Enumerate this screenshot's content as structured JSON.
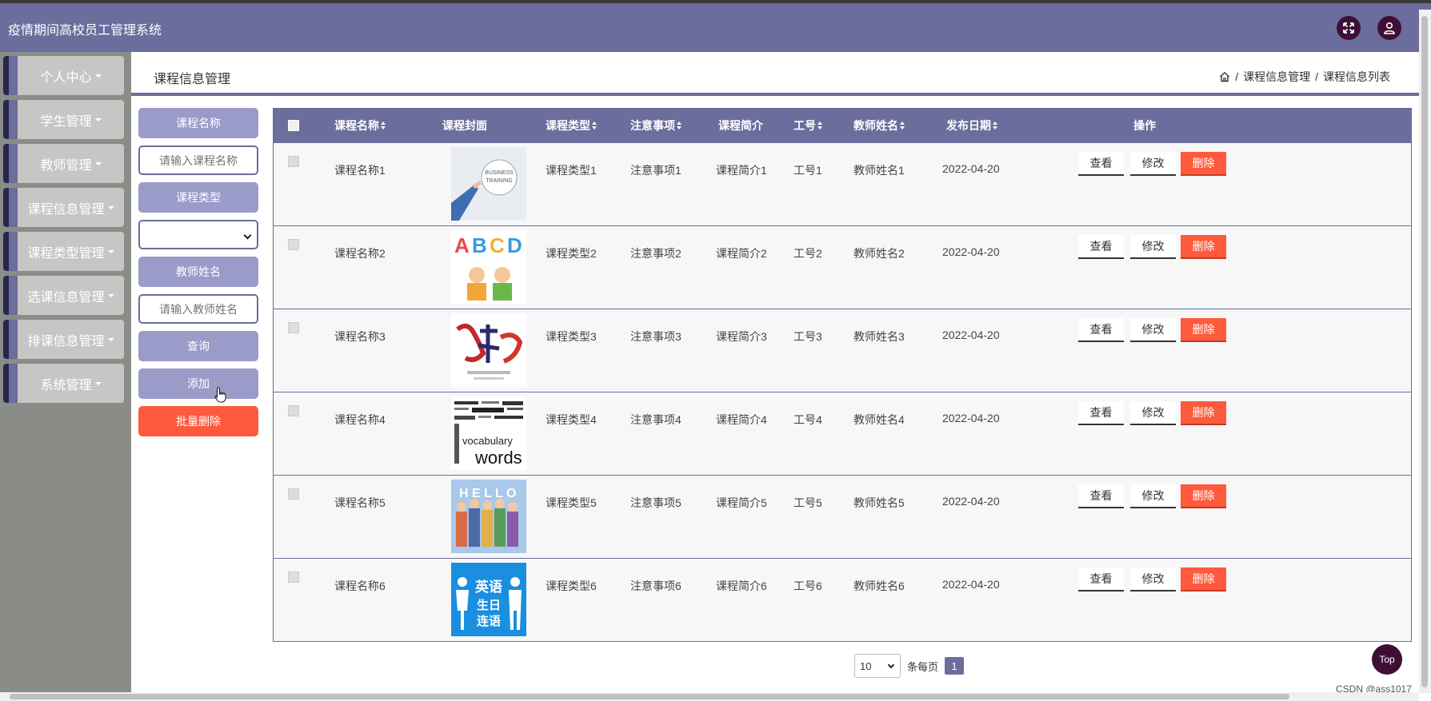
{
  "app": {
    "title": "疫情期间高校员工管理系统"
  },
  "header_icons": {
    "fullscreen": "fullscreen-icon",
    "user": "user-icon"
  },
  "sidebar": {
    "items": [
      {
        "label": "个人中心"
      },
      {
        "label": "学生管理"
      },
      {
        "label": "教师管理"
      },
      {
        "label": "课程信息管理"
      },
      {
        "label": "课程类型管理"
      },
      {
        "label": "选课信息管理"
      },
      {
        "label": "排课信息管理"
      },
      {
        "label": "系统管理"
      }
    ]
  },
  "page": {
    "title": "课程信息管理",
    "breadcrumb": {
      "sep": "/",
      "level1": "课程信息管理",
      "level2": "课程信息列表"
    }
  },
  "filters": {
    "name_label": "课程名称",
    "name_placeholder": "请输入课程名称",
    "type_label": "课程类型",
    "type_value": "",
    "teacher_label": "教师姓名",
    "teacher_placeholder": "请输入教师姓名",
    "search_label": "查询",
    "add_label": "添加",
    "batch_delete_label": "批量删除"
  },
  "table": {
    "headers": {
      "name": "课程名称",
      "cover": "课程封面",
      "type": "课程类型",
      "notes": "注意事项",
      "intro": "课程简介",
      "id": "工号",
      "teacher": "教师姓名",
      "date": "发布日期",
      "actions": "操作"
    },
    "action_labels": {
      "view": "查看",
      "edit": "修改",
      "delete": "删除"
    },
    "rows": [
      {
        "name": "课程名称1",
        "type": "课程类型1",
        "notes": "注意事项1",
        "intro": "课程简介1",
        "id": "工号1",
        "teacher": "教师姓名1",
        "date": "2022-04-20",
        "cover_text": "BUSINESS TRAINING"
      },
      {
        "name": "课程名称2",
        "type": "课程类型2",
        "notes": "注意事项2",
        "intro": "课程简介2",
        "id": "工号2",
        "teacher": "教师姓名2",
        "date": "2022-04-20",
        "cover_text": "ABCD"
      },
      {
        "name": "课程名称3",
        "type": "课程类型3",
        "notes": "注意事项3",
        "intro": "课程简介3",
        "id": "工号3",
        "teacher": "教师姓名3",
        "date": "2022-04-20",
        "cover_text": "健身操"
      },
      {
        "name": "课程名称4",
        "type": "课程类型4",
        "notes": "注意事项4",
        "intro": "课程简介4",
        "id": "工号4",
        "teacher": "教师姓名4",
        "date": "2022-04-20",
        "cover_text": "vocabulary words"
      },
      {
        "name": "课程名称5",
        "type": "课程类型5",
        "notes": "注意事项5",
        "intro": "课程简介5",
        "id": "工号5",
        "teacher": "教师姓名5",
        "date": "2022-04-20",
        "cover_text": "HELLO"
      },
      {
        "name": "课程名称6",
        "type": "课程类型6",
        "notes": "注意事项6",
        "intro": "课程简介6",
        "id": "工号6",
        "teacher": "教师姓名6",
        "date": "2022-04-20",
        "cover_text": "英语 生日 连语"
      }
    ]
  },
  "pagination": {
    "page_size": "10",
    "per_page_label": "条每页",
    "current_page": "1"
  },
  "top_button": "Top",
  "watermark": "CSDN @ass1017",
  "colors": {
    "primary": "#6b6d9c",
    "accent_dark": "#3e0f35",
    "danger": "#ff5a3c",
    "filter_label": "#9a9bc9"
  }
}
